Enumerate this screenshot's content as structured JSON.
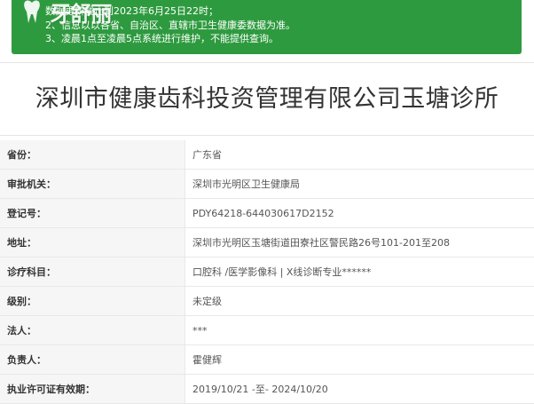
{
  "notice": {
    "lines": [
      "数据更新截止到2023年6月25日22时；",
      "2、信息以以各省、自治区、直辖市卫生健康委数据为准。",
      "3、凌晨1点至凌晨5点系统进行维护，不能提供查询。"
    ]
  },
  "watermark": {
    "text": "牙舒丽",
    "icon": "tooth-logo-icon"
  },
  "page": {
    "title": "深圳市健康齿科投资管理有限公司玉塘诊所"
  },
  "info": {
    "rows": [
      {
        "label": "省份：",
        "value": "广东省"
      },
      {
        "label": "审批机关：",
        "value": "深圳市光明区卫生健康局"
      },
      {
        "label": "登记号：",
        "value": "PDY64218-644030617D2152"
      },
      {
        "label": "地址：",
        "value": "深圳市光明区玉塘街道田寮社区警民路26号101-201至208"
      },
      {
        "label": "诊疗科目：",
        "value": "口腔科 /医学影像科 | X线诊断专业******"
      },
      {
        "label": "级别：",
        "value": "未定级"
      },
      {
        "label": "法人：",
        "value": "***"
      },
      {
        "label": "负责人：",
        "value": "霍健辉"
      },
      {
        "label": "执业许可证有效期：",
        "value": "2019/10/21 -至- 2024/10/20"
      }
    ]
  },
  "colors": {
    "notice_bg": "#2e9a3f",
    "label_bg": "#f6f6f6",
    "border": "#e8e8e8"
  }
}
